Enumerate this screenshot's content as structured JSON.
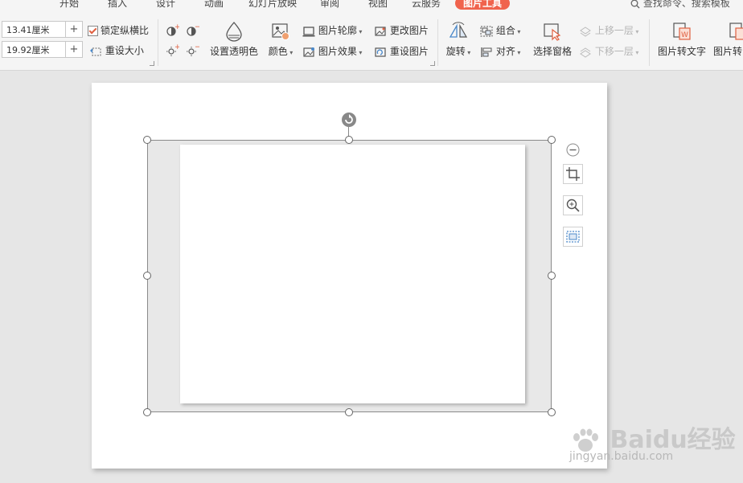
{
  "tabs": [
    "开始",
    "插入",
    "设计",
    "动画",
    "幻灯片放映",
    "审阅",
    "视图",
    "云服务",
    "图片工具"
  ],
  "search_text": "查找命令、搜索模板",
  "size": {
    "height": "13.41厘米",
    "width": "19.92厘米",
    "plus": "+"
  },
  "lock_ratio": "锁定纵横比",
  "reset_size": "重设大小",
  "transparent": "设置透明色",
  "color": "颜色",
  "outline": "图片轮廓",
  "effect": "图片效果",
  "change_pic": "更改图片",
  "reset_pic": "重设图片",
  "rotate": "旋转",
  "group": "组合",
  "align": "对齐",
  "selection_pane": "选择窗格",
  "bring_forward": "上移一层",
  "send_backward": "下移一层",
  "pic_to_text": "图片转文字",
  "pic_to_more": "图片转",
  "watermark": {
    "logo": "Baidu经验",
    "url": "jingyan.baidu.com"
  },
  "colors": {
    "accent": "#f0634d"
  }
}
